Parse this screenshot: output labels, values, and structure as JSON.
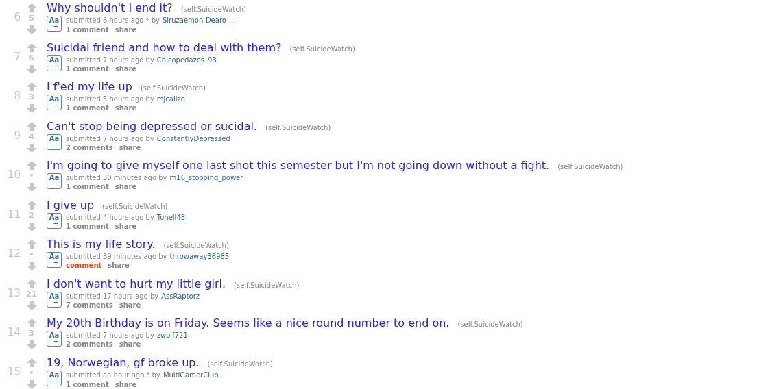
{
  "posts": [
    {
      "rank": "6",
      "score": "5",
      "title": "Why shouldn't I end it?",
      "domain": "(self.SuicideWatch)",
      "thumb": "Aa",
      "thumb_mark": "+",
      "submitted": "submitted 6 hours ago * by",
      "author": "Siruzaemon-Dearo",
      "more": "…",
      "comments": "1 comment",
      "comments_empty": false,
      "share": "share"
    },
    {
      "rank": "7",
      "score": "5",
      "title": "Suicidal friend and how to deal with them?",
      "domain": "(self.SuicideWatch)",
      "thumb": "Aa",
      "thumb_mark": "+",
      "submitted": "submitted 7 hours ago by",
      "author": "Chicopedazos_93",
      "comments": "1 comment",
      "comments_empty": false,
      "share": "share"
    },
    {
      "rank": "8",
      "score": "3",
      "title": "I f'ed my life up",
      "domain": "(self.SuicideWatch)",
      "thumb": "Aa",
      "thumb_mark": "+",
      "submitted": "submitted 5 hours ago by",
      "author": "mjcalizo",
      "comments": "1 comment",
      "comments_empty": false,
      "share": "share"
    },
    {
      "rank": "9",
      "score": "4",
      "title": "Can't stop being depressed or sucidal.",
      "domain": "(self.SuicideWatch)",
      "thumb": "Aa",
      "thumb_mark": "+",
      "submitted": "submitted 7 hours ago by",
      "author": "ConstantlyDepressed",
      "comments": "2 comments",
      "comments_empty": false,
      "share": "share"
    },
    {
      "rank": "10",
      "score": "•",
      "title": "I'm going to give myself one last shot this semester but I'm not going down without a fight.",
      "domain": "(self.SuicideWatch)",
      "thumb": "Aa",
      "thumb_mark": "+",
      "submitted": "submitted 30 minutes ago by",
      "author": "m16_stopping_power",
      "comments": "1 comment",
      "comments_empty": false,
      "share": "share"
    },
    {
      "rank": "11",
      "score": "2",
      "title": "I give up",
      "domain": "(self.SuicideWatch)",
      "thumb": "Aa",
      "thumb_mark": "+",
      "submitted": "submitted 4 hours ago by",
      "author": "Tohell48",
      "comments": "1 comment",
      "comments_empty": false,
      "share": "share"
    },
    {
      "rank": "12",
      "score": "•",
      "title": "This is my life story.",
      "domain": "(self.SuicideWatch)",
      "thumb": "Aa",
      "thumb_mark": "+",
      "submitted": "submitted 39 minutes ago by",
      "author": "throwaway36985",
      "comments": "comment",
      "comments_empty": true,
      "share": "share"
    },
    {
      "rank": "13",
      "score": "21",
      "title": "I don't want to hurt my little girl.",
      "domain": "(self.SuicideWatch)",
      "thumb": "Aa",
      "thumb_mark": "+",
      "submitted": "submitted 17 hours ago by",
      "author": "AssRaptorz",
      "comments": "7 comments",
      "comments_empty": false,
      "share": "share"
    },
    {
      "rank": "14",
      "score": "3",
      "title": "My 20th Birthday is on Friday. Seems like a nice round number to end on.",
      "domain": "(self.SuicideWatch)",
      "thumb": "Aa",
      "thumb_mark": "+",
      "submitted": "submitted 7 hours ago by",
      "author": "zwolf721",
      "comments": "2 comments",
      "comments_empty": false,
      "share": "share"
    },
    {
      "rank": "15",
      "score": "•",
      "title": "19, Norwegian, gf broke up.",
      "domain": "(self.SuicideWatch)",
      "thumb": "Aa",
      "thumb_mark": "+",
      "submitted": "submitted an hour ago * by",
      "author": "MultiGamerClub",
      "more": "…",
      "comments": "1 comment",
      "comments_empty": false,
      "share": "share"
    }
  ]
}
